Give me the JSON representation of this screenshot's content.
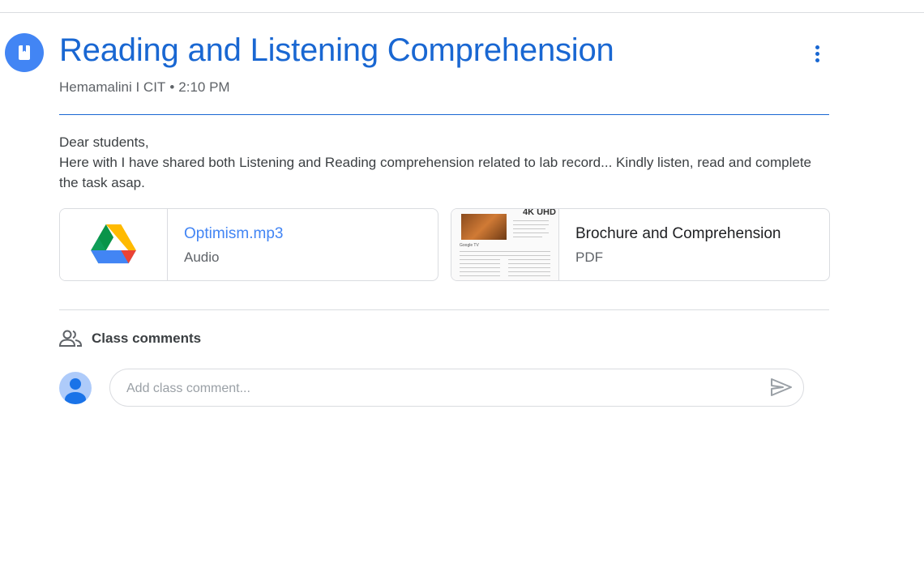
{
  "post": {
    "title": "Reading and Listening Comprehension",
    "author": "Hemamalini I CIT",
    "separator": "•",
    "time": "2:10 PM",
    "body_line1": "Dear students,",
    "body_line2": "Here with I have shared both Listening and Reading comprehension related to lab record... Kindly listen, read and complete the task asap."
  },
  "attachments": [
    {
      "name": "Optimism.mp3",
      "type": "Audio",
      "icon": "google-drive-icon"
    },
    {
      "name": "Brochure and Comprehension",
      "type": "PDF",
      "icon": "pdf-thumbnail"
    }
  ],
  "pdf_thumb": {
    "heading": "4K UHD",
    "caption": "Google TV"
  },
  "comments": {
    "header": "Class comments",
    "placeholder": "Add class comment..."
  },
  "colors": {
    "accent": "#1967d2",
    "icon_bg": "#4285f4",
    "avatar_bg": "#aecbfa"
  },
  "icons": [
    "assignment-bookmark-icon",
    "more-vert-icon",
    "people-icon",
    "avatar-icon",
    "send-icon"
  ]
}
